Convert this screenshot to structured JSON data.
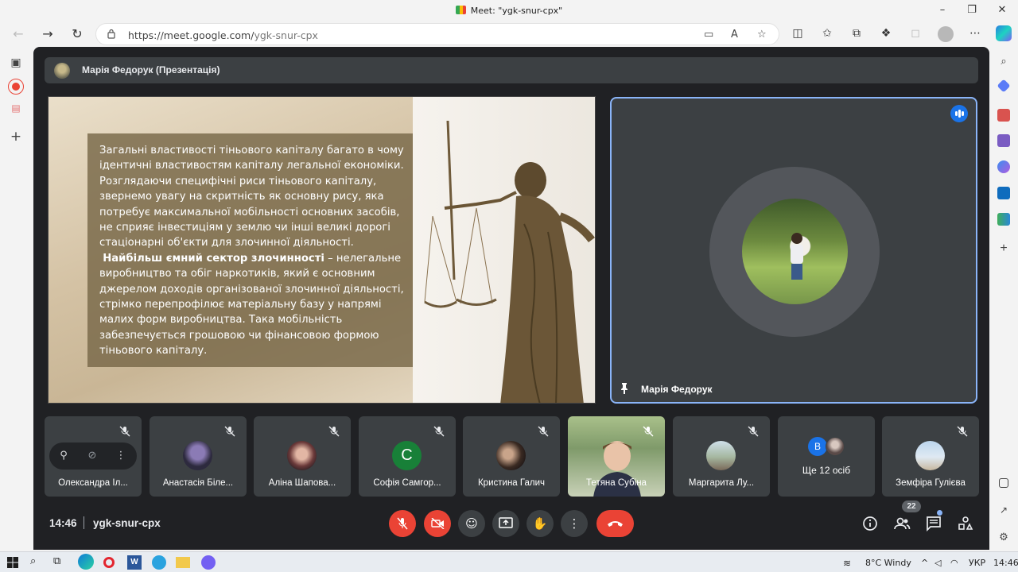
{
  "window": {
    "title": "Meet: \"ygk-snur-cpx\""
  },
  "browser": {
    "url_main": "https://meet.google.com/",
    "url_path": "ygk-snur-cpx"
  },
  "presentation": {
    "bar_label": "Марія Федорук (Презентація)",
    "slide_paragraph1": " Загальні властивості тіньового капіталу багато в чому ідентичні властивостям капіталу легальної економіки. Розглядаючи специфічні риси тіньового капіталу, звернемо увагу на скритність як основну рису, яка потребує максимальної мобільності основних засобів, не сприяє інвестиціям у землю чи інші великі дорогі стаціонарні об'єкти для злочинної діяльності.",
    "slide_bold": "Найбільш ємний сектор злочинності",
    "slide_paragraph2": " – нелегальне виробництво та обіг наркотиків, який є основним джерелом доходів організованої злочинної діяльності, стрімко перепрофілює матеріальну базу у напрямі малих форм виробництва. Така мобільність забезпечується грошовою чи фінансовою формою тіньового капіталу."
  },
  "speaker": {
    "name": "Марія Федорук"
  },
  "participants": [
    {
      "name": "Олександра Іл..."
    },
    {
      "name": "Анастасія Біле..."
    },
    {
      "name": "Аліна Шапова..."
    },
    {
      "name": "Софія Самгор...",
      "letter": "С"
    },
    {
      "name": "Кристина Галич"
    },
    {
      "name": "Тетяна Субіна"
    },
    {
      "name": "Маргарита Лу..."
    },
    {
      "name": "Ще 12 осіб",
      "letter": "В"
    },
    {
      "name": "Земфіра Гулієва"
    }
  ],
  "bottom": {
    "time": "14:46",
    "meeting_code": "ygk-snur-cpx",
    "people_count": "22"
  },
  "taskbar": {
    "weather": "8°C  Windy",
    "lang": "УКР",
    "clock": "14:46"
  },
  "colors": {
    "meet_bg": "#202124",
    "tile_bg": "#3c4043",
    "accent_blue": "#8ab4f8",
    "end_red": "#ea4335"
  }
}
